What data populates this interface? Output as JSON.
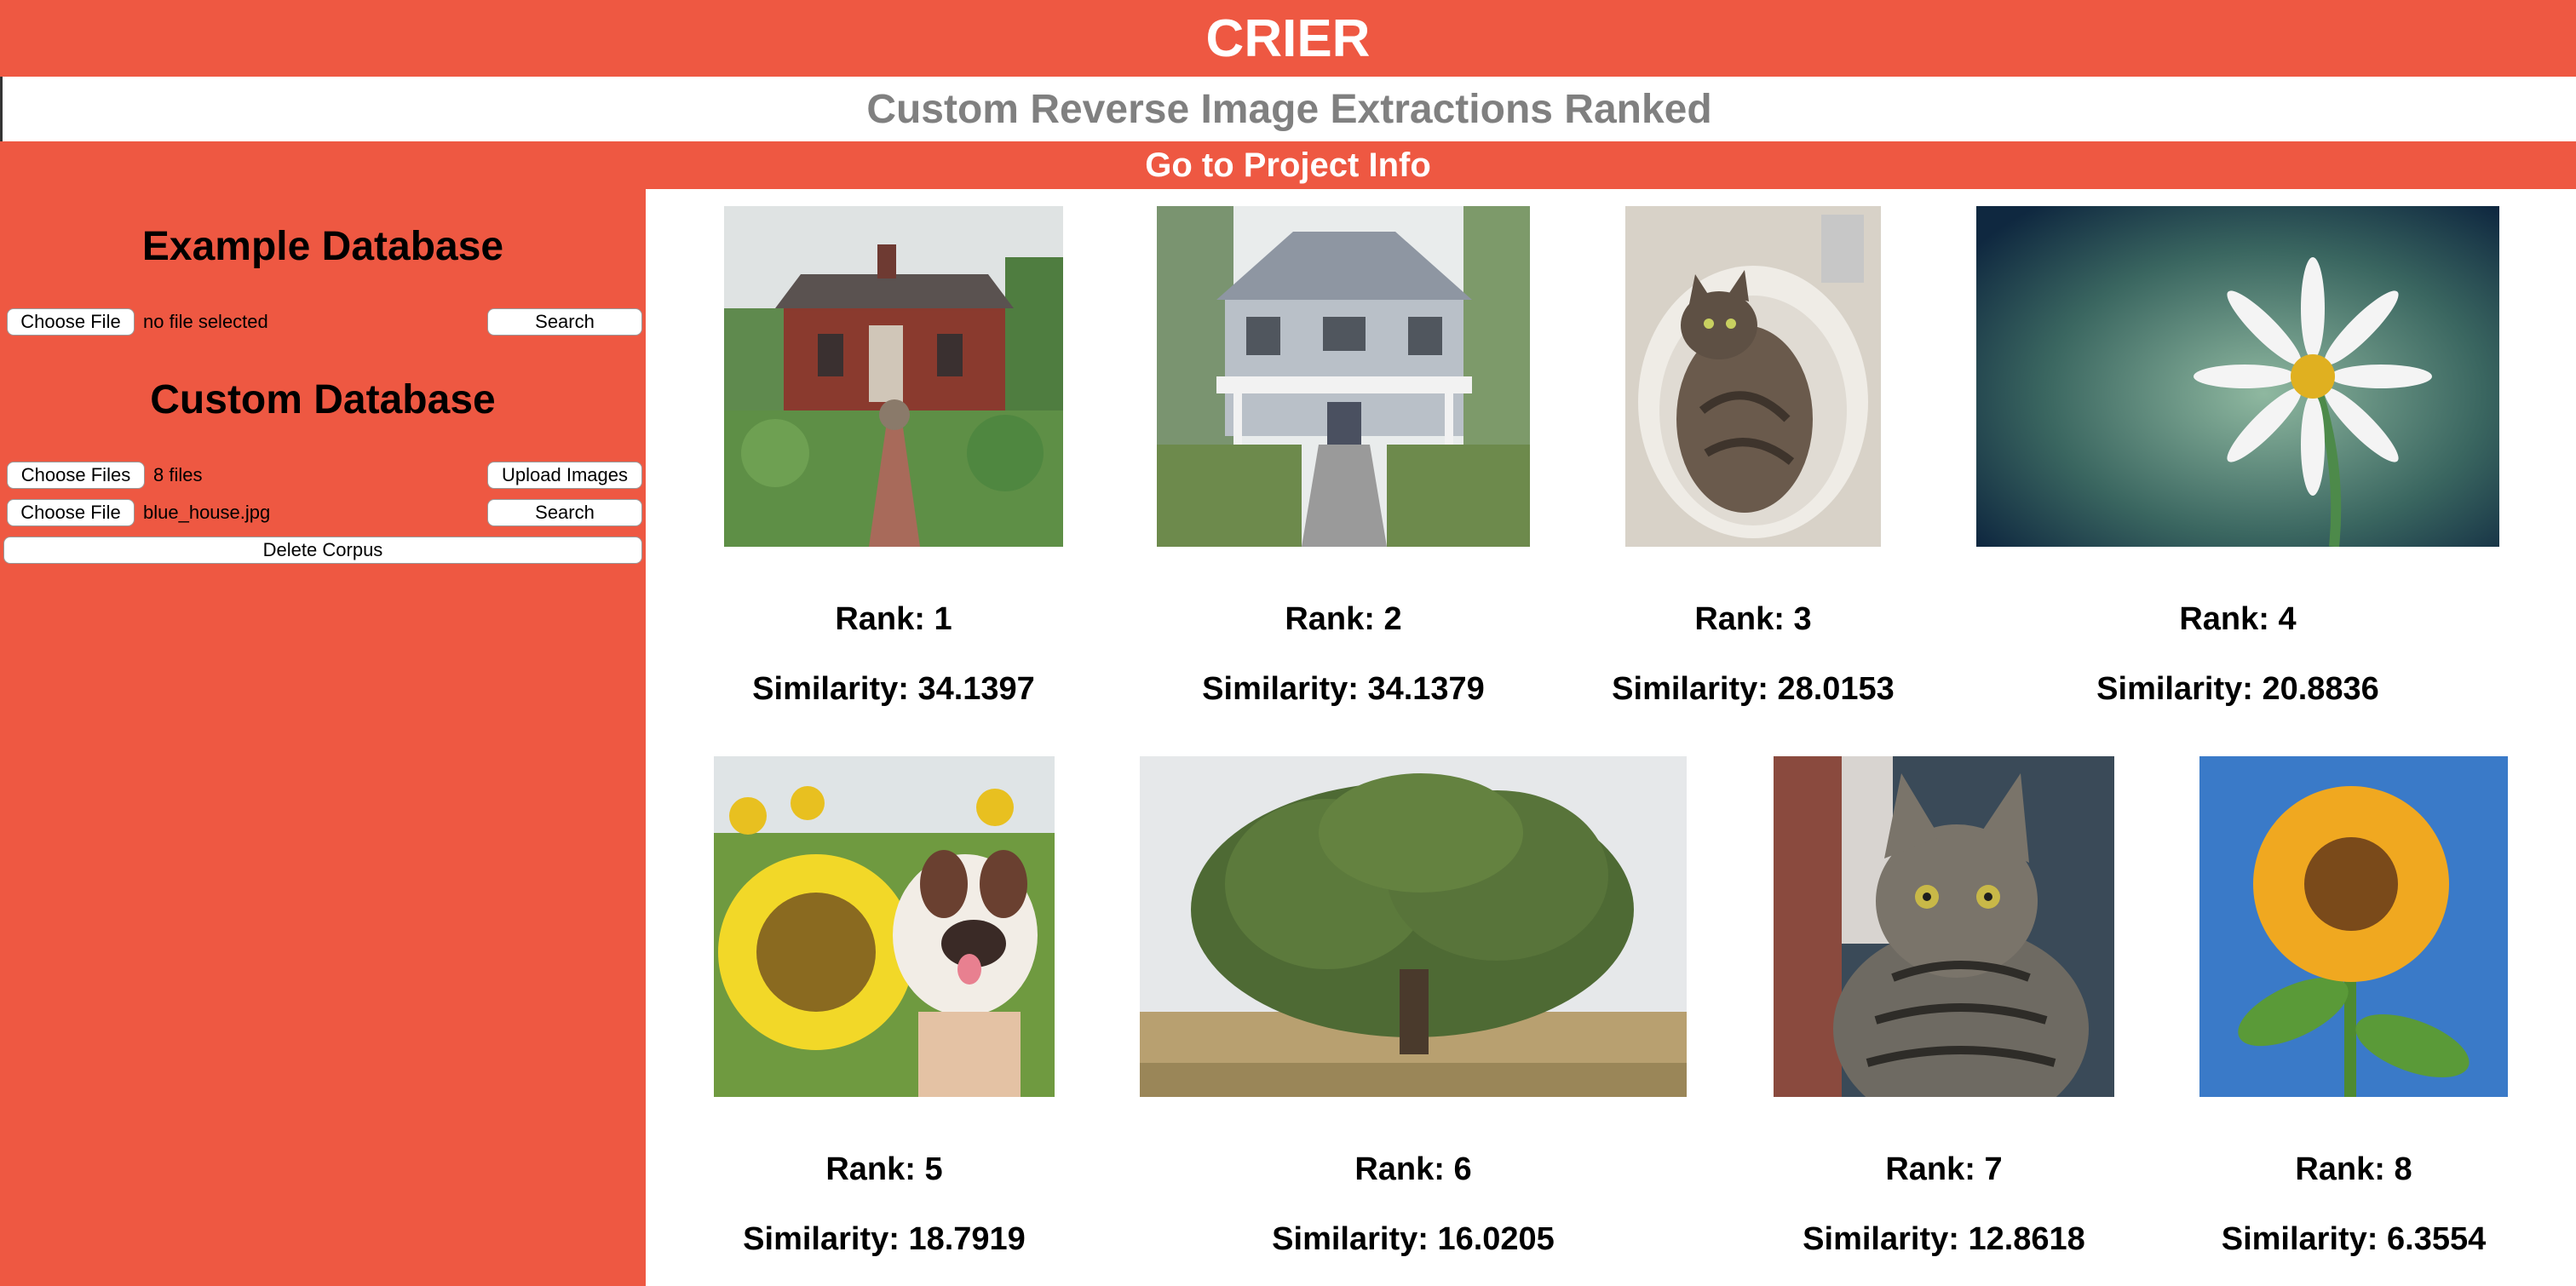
{
  "header": {
    "title": "CRIER",
    "subtitle": "Custom Reverse Image Extractions Ranked",
    "info_link": "Go to Project Info"
  },
  "sidebar": {
    "example": {
      "heading": "Example Database",
      "choose_label": "Choose File",
      "file_status": "no file selected",
      "search_label": "Search"
    },
    "custom": {
      "heading": "Custom Database",
      "choose_files_label": "Choose Files",
      "files_status": "8 files",
      "upload_label": "Upload Images",
      "choose_label": "Choose File",
      "file_status": "blue_house.jpg",
      "search_label": "Search",
      "delete_label": "Delete Corpus"
    }
  },
  "results": [
    {
      "rank": "Rank: 1",
      "similarity": "Similarity: 34.1397",
      "image": "red-cottage-garden"
    },
    {
      "rank": "Rank: 2",
      "similarity": "Similarity: 34.1379",
      "image": "white-house-porch"
    },
    {
      "rank": "Rank: 3",
      "similarity": "Similarity: 28.0153",
      "image": "cat-in-sink"
    },
    {
      "rank": "Rank: 4",
      "similarity": "Similarity: 20.8836",
      "image": "white-daisy"
    },
    {
      "rank": "Rank: 5",
      "similarity": "Similarity: 18.7919",
      "image": "puppy-sunflower"
    },
    {
      "rank": "Rank: 6",
      "similarity": "Similarity: 16.0205",
      "image": "large-oak-tree"
    },
    {
      "rank": "Rank: 7",
      "similarity": "Similarity: 12.8618",
      "image": "tabby-cat"
    },
    {
      "rank": "Rank: 8",
      "similarity": "Similarity: 6.3554",
      "image": "sunflower-sky"
    }
  ],
  "colors": {
    "accent": "#ee5842",
    "subtitle_text": "#808080"
  }
}
